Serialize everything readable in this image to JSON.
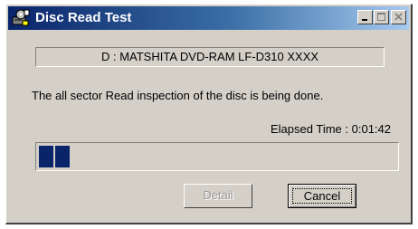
{
  "window": {
    "title": "Disc Read Test",
    "icon": "disc-drive-icon",
    "controls": [
      "minimize-icon",
      "maximize-icon",
      "close-icon"
    ]
  },
  "device": {
    "label": "D : MATSHITA DVD-RAM LF-D310 XXXX"
  },
  "status": {
    "message": "The all sector Read inspection of the disc is being done."
  },
  "elapsed": {
    "label": "Elapsed Time :",
    "value": "0:01:42"
  },
  "progress": {
    "blocks_filled": 2,
    "color": "#0a246a"
  },
  "buttons": {
    "detail_label": "Detail",
    "detail_enabled": false,
    "cancel_label": "Cancel"
  },
  "colors": {
    "titlebar_start": "#0a246a",
    "titlebar_end": "#a6caf0",
    "face": "#d4d0c8"
  }
}
